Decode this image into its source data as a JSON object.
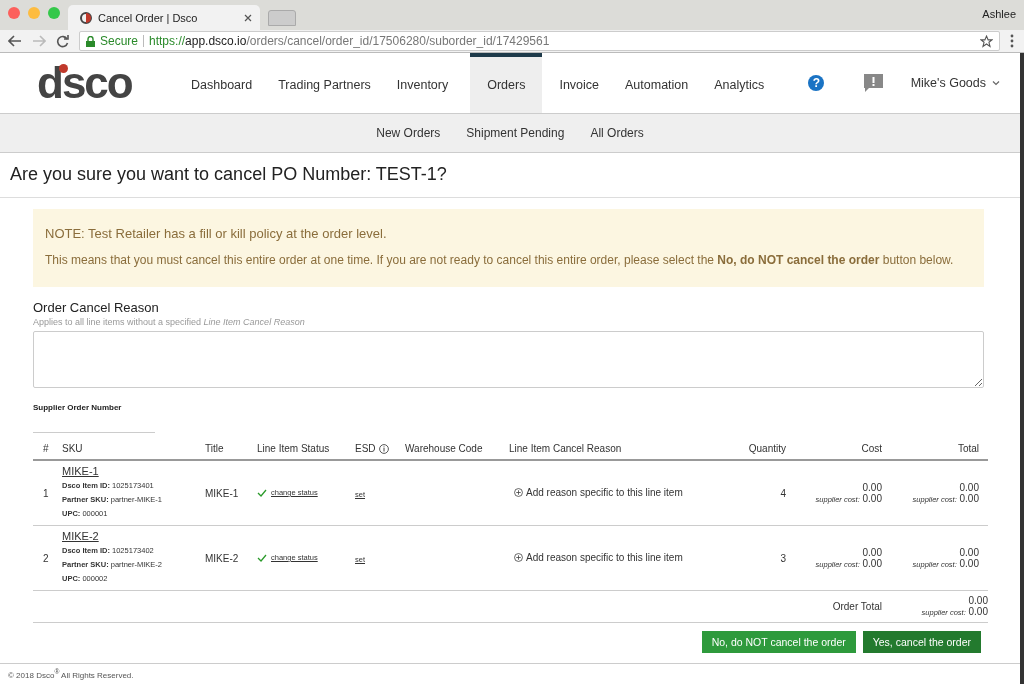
{
  "browser": {
    "tab_title": "Cancel Order | Dsco",
    "profile": "Ashlee",
    "secure_label": "Secure",
    "url": {
      "scheme": "https://",
      "host": "app.dsco.io",
      "path": "/orders/cancel/order_id/17506280/suborder_id/17429561"
    }
  },
  "header": {
    "logo": "dsco",
    "nav": [
      {
        "label": "Dashboard",
        "selected": false
      },
      {
        "label": "Trading Partners",
        "selected": false
      },
      {
        "label": "Inventory",
        "selected": false
      },
      {
        "label": "Orders",
        "selected": true
      },
      {
        "label": "Invoice",
        "selected": false
      },
      {
        "label": "Automation",
        "selected": false
      },
      {
        "label": "Analytics",
        "selected": false
      }
    ],
    "help_icon": "?",
    "account": "Mike's Goods"
  },
  "subnav": [
    "New Orders",
    "Shipment Pending",
    "All Orders"
  ],
  "page_title": "Are you sure you want to cancel PO Number: TEST-1?",
  "notice": {
    "title": "NOTE: Test Retailer has a fill or kill policy at the order level.",
    "body": "This means that you must cancel this entire order at one time. If you are not ready to cancel this entire order, please select the **No, do NOT cancel the order** button below."
  },
  "cancel_reason": {
    "label": "Order Cancel Reason",
    "hint": "Applies to all line items without a specified *Line Item Cancel Reason*"
  },
  "supplier_order_number": {
    "label": "Supplier Order Number"
  },
  "table": {
    "columns": [
      "#",
      "SKU",
      "Title",
      "Line Item Status",
      "ESD",
      "Warehouse Code",
      "Line Item Cancel Reason",
      "Quantity",
      "Cost",
      "Total"
    ],
    "rows": [
      {
        "number": "1",
        "sku": "MIKE-1",
        "item_id": "**Dsco Item ID:** 1025173401",
        "partner_sku": "**Partner SKU:** partner-MIKE-1",
        "upc": "**UPC:** 000001",
        "title": "MIKE-1",
        "status_link": "change status",
        "esd_link": "set",
        "reason_link": "Add reason specific to this line item",
        "quantity": "4",
        "cost": "0.00",
        "supplier_cost_label": "supplier cost:",
        "supplier_cost": "0.00",
        "total": "0.00",
        "supplier_total_label": "supplier cost:",
        "supplier_total": "0.00"
      },
      {
        "number": "2",
        "sku": "MIKE-2",
        "item_id": "**Dsco Item ID:** 1025173402",
        "partner_sku": "**Partner SKU:** partner-MIKE-2",
        "upc": "**UPC:** 000002",
        "title": "MIKE-2",
        "status_link": "change status",
        "esd_link": "set",
        "reason_link": "Add reason specific to this line item",
        "quantity": "3",
        "cost": "0.00",
        "supplier_cost_label": "supplier cost:",
        "supplier_cost": "0.00",
        "total": "0.00",
        "supplier_total_label": "supplier cost:",
        "supplier_total": "0.00"
      }
    ],
    "order_total": {
      "label": "Order Total",
      "total": "0.00",
      "supplier_cost_label": "supplier cost:",
      "supplier_cost": "0.00"
    }
  },
  "buttons": [
    "No, do NOT cancel the order",
    "Yes, cancel the order"
  ],
  "footer": "© 2018 Dsco$^{®}$ All Rights Reserved."
}
